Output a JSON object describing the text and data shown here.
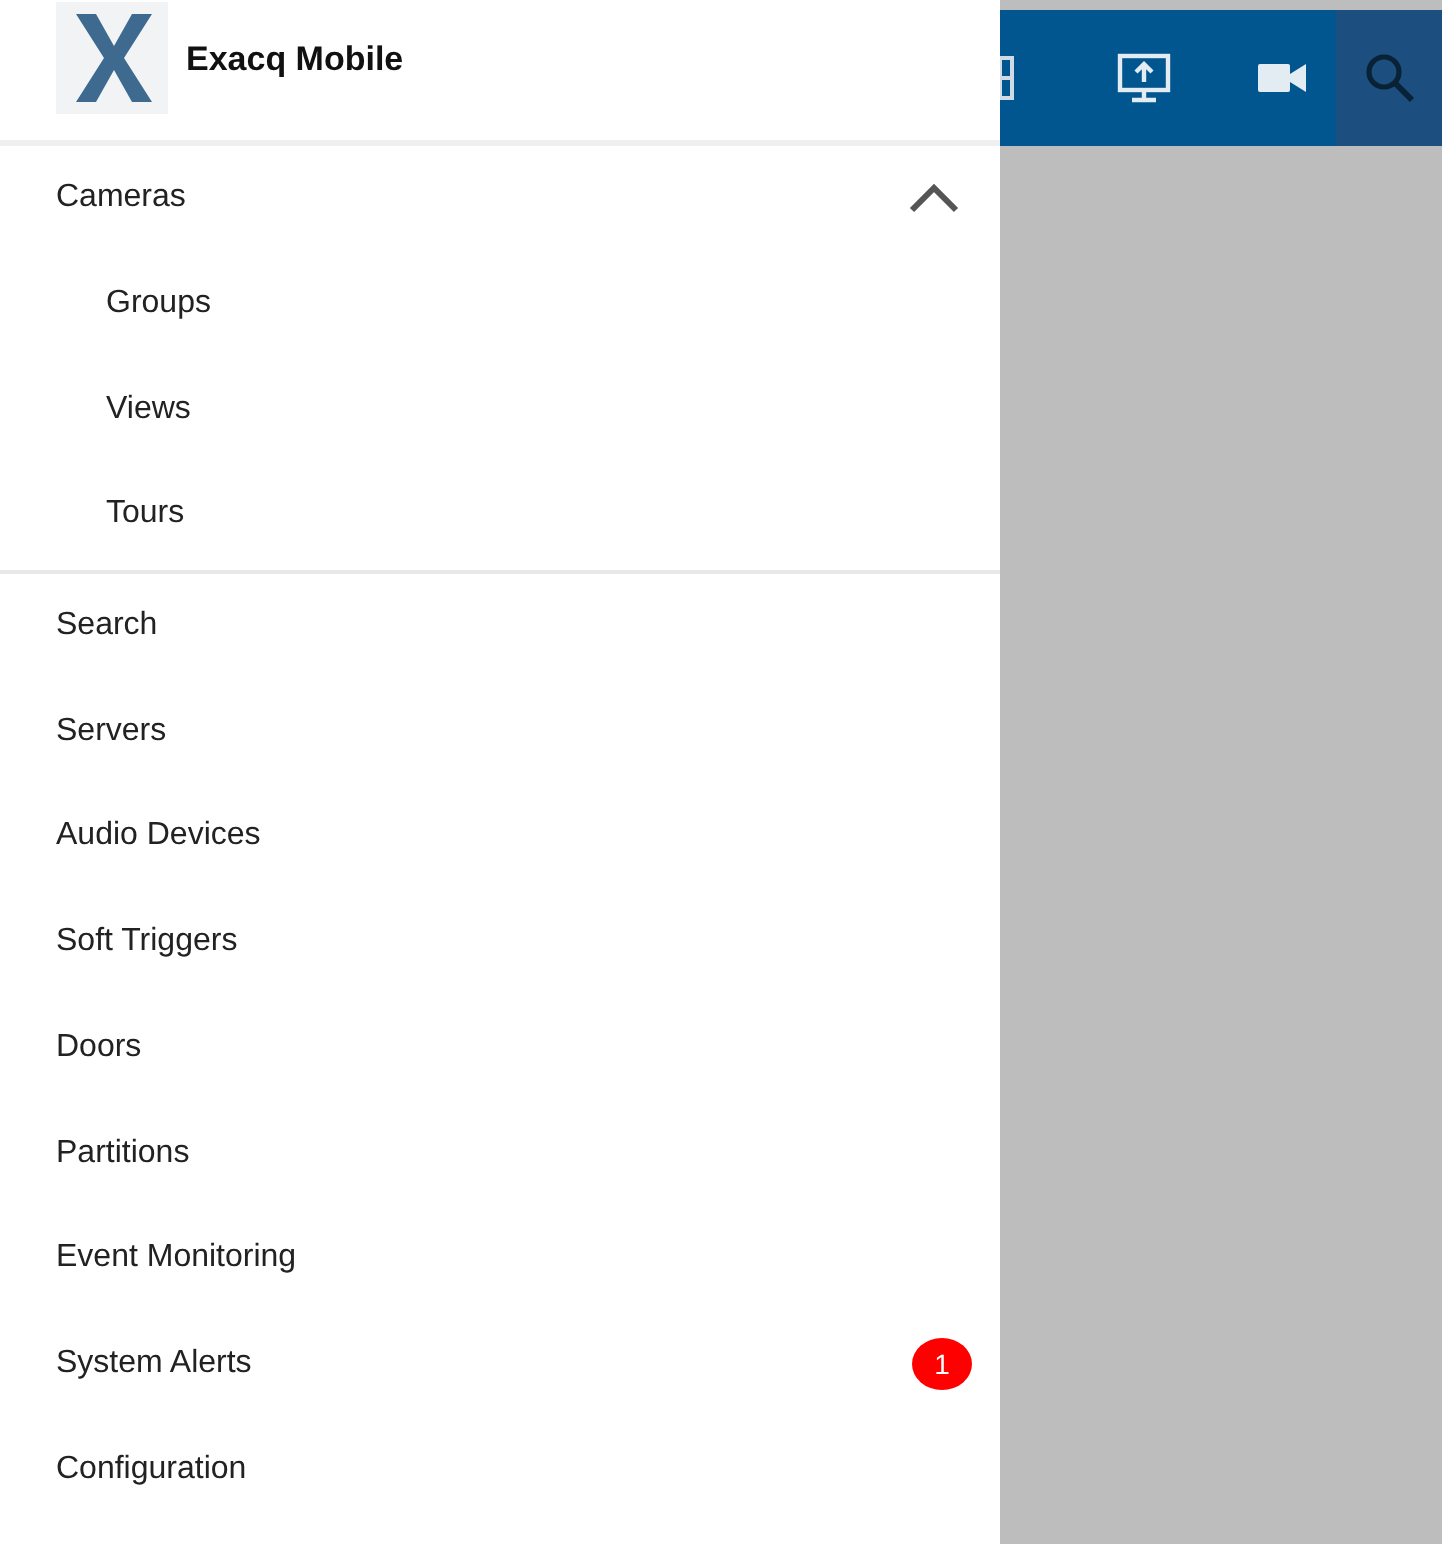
{
  "app": {
    "title": "Exacq Mobile"
  },
  "menu": [
    {
      "label": "Cameras",
      "expanded": true,
      "children": [
        {
          "label": "Groups"
        },
        {
          "label": "Views"
        },
        {
          "label": "Tours"
        }
      ]
    },
    {
      "label": "Search"
    },
    {
      "label": "Servers"
    },
    {
      "label": "Audio Devices"
    },
    {
      "label": "Soft Triggers"
    },
    {
      "label": "Doors"
    },
    {
      "label": "Partitions"
    },
    {
      "label": "Event Monitoring"
    },
    {
      "label": "System Alerts",
      "badge": "1"
    },
    {
      "label": "Configuration"
    }
  ]
}
